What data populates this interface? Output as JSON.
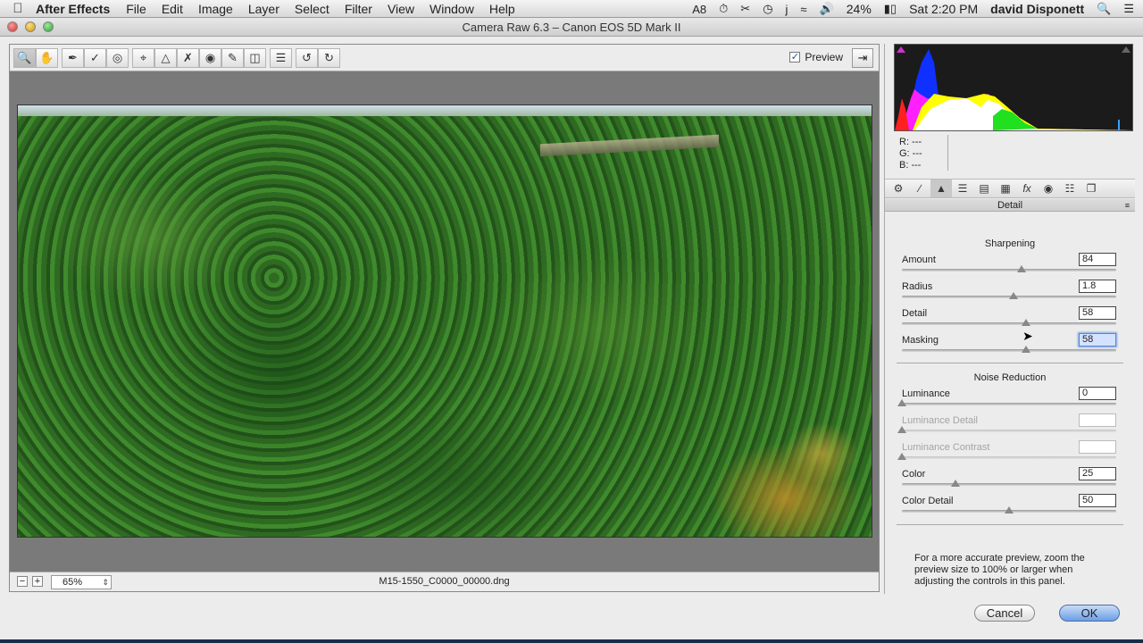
{
  "menubar": {
    "app": "After Effects",
    "items": [
      "File",
      "Edit",
      "Image",
      "Layer",
      "Select",
      "Filter",
      "View",
      "Window",
      "Help"
    ],
    "status_items": [
      "8"
    ],
    "battery": "24%",
    "clock": "Sat 2:20 PM",
    "user": "david Disponett"
  },
  "window": {
    "title": "Camera Raw 6.3  –  Canon EOS 5D Mark II"
  },
  "toolbar": {
    "preview_label": "Preview",
    "preview_checked": true
  },
  "status": {
    "zoom": "65%",
    "filename": "M15-1550_C0000_00000.dng"
  },
  "info": {
    "r": "R:  ---",
    "g": "G:  ---",
    "b": "B:  ---"
  },
  "panel": {
    "title": "Detail",
    "sharpening_title": "Sharpening",
    "sharpening": [
      {
        "label": "Amount",
        "value": "84",
        "pos": 0.56
      },
      {
        "label": "Radius",
        "value": "1.8",
        "pos": 0.52
      },
      {
        "label": "Detail",
        "value": "58",
        "pos": 0.58
      },
      {
        "label": "Masking",
        "value": "58",
        "pos": 0.58
      }
    ],
    "noise_title": "Noise Reduction",
    "noise": [
      {
        "label": "Luminance",
        "value": "0",
        "pos": 0.0
      },
      {
        "label": "Luminance Detail",
        "value": "",
        "pos": 0.0,
        "disabled": true
      },
      {
        "label": "Luminance Contrast",
        "value": "",
        "pos": 0.0,
        "disabled": true
      },
      {
        "label": "Color",
        "value": "25",
        "pos": 0.25
      },
      {
        "label": "Color Detail",
        "value": "50",
        "pos": 0.5
      }
    ],
    "note": "For a more accurate preview, zoom the preview size to 100% or larger when adjusting the controls in this panel."
  },
  "buttons": {
    "cancel": "Cancel",
    "ok": "OK"
  },
  "colors": {
    "accent": "#6a9ee6",
    "histogram_blue": "#1030ff",
    "histogram_yellow": "#ffff00",
    "histogram_magenta": "#ff20ff",
    "histogram_green": "#20e020"
  }
}
